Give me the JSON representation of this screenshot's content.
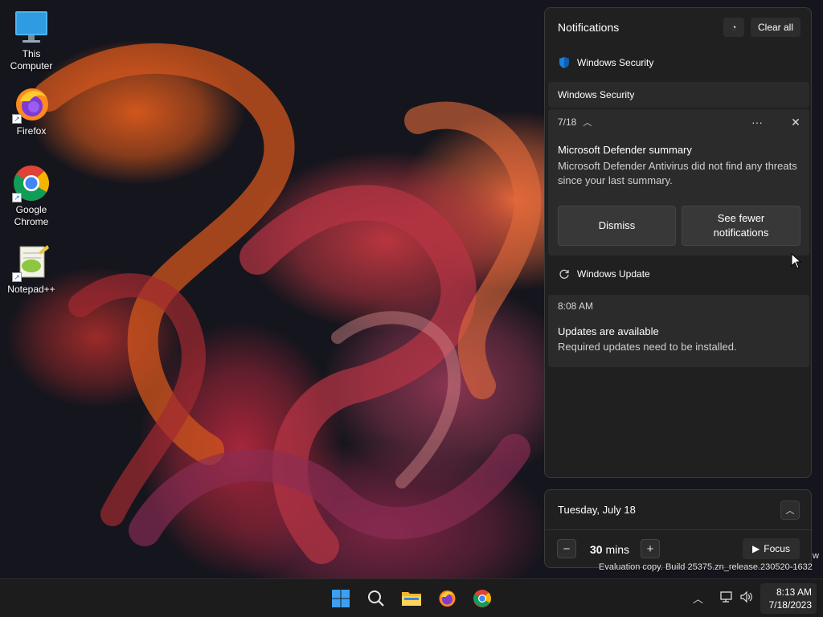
{
  "desktop": {
    "icons": [
      {
        "label_line1": "This",
        "label_line2": "Computer",
        "icon": "monitor-icon"
      },
      {
        "label_line1": "Firefox",
        "label_line2": "",
        "icon": "firefox-icon"
      },
      {
        "label_line1": "Google",
        "label_line2": "Chrome",
        "icon": "chrome-icon"
      },
      {
        "label_line1": "Notepad++",
        "label_line2": "",
        "icon": "notepadpp-icon"
      }
    ],
    "watermark": "Evaluation copy. Build 25375.zn_release.230520-1632",
    "watermark_fragment": "w"
  },
  "notifications": {
    "title": "Notifications",
    "focus_icon": "focus-assist-icon",
    "clear_all": "Clear all",
    "app1": {
      "name": "Windows Security",
      "icon": "shield-icon"
    },
    "group_header": "Windows Security",
    "toast1": {
      "date": "7/18",
      "title": "Microsoft Defender summary",
      "body": "Microsoft Defender Antivirus did not find any threats since your last summary.",
      "dismiss": "Dismiss",
      "see_fewer": "See fewer notifications",
      "more": "···",
      "close": "✕"
    },
    "app2": {
      "name": "Windows Update",
      "icon": "refresh-icon"
    },
    "toast2": {
      "time": "8:08 AM",
      "title": "Updates are available",
      "body": "Required updates need to be installed."
    }
  },
  "calendar": {
    "date": "Tuesday, July 18",
    "focus_minutes": "30",
    "focus_unit": "mins",
    "focus_label": "Focus"
  },
  "taskbar": {
    "clock_time": "8:13 AM",
    "clock_date": "7/18/2023",
    "apps": [
      "start-icon",
      "search-icon",
      "file-explorer-icon",
      "firefox-icon",
      "chrome-icon"
    ]
  },
  "colors": {
    "panel_bg": "#202020",
    "toast_bg": "#2b2b2b",
    "accent_blue": "#0a84ff",
    "taskbar_bg": "#1c1c1c"
  }
}
